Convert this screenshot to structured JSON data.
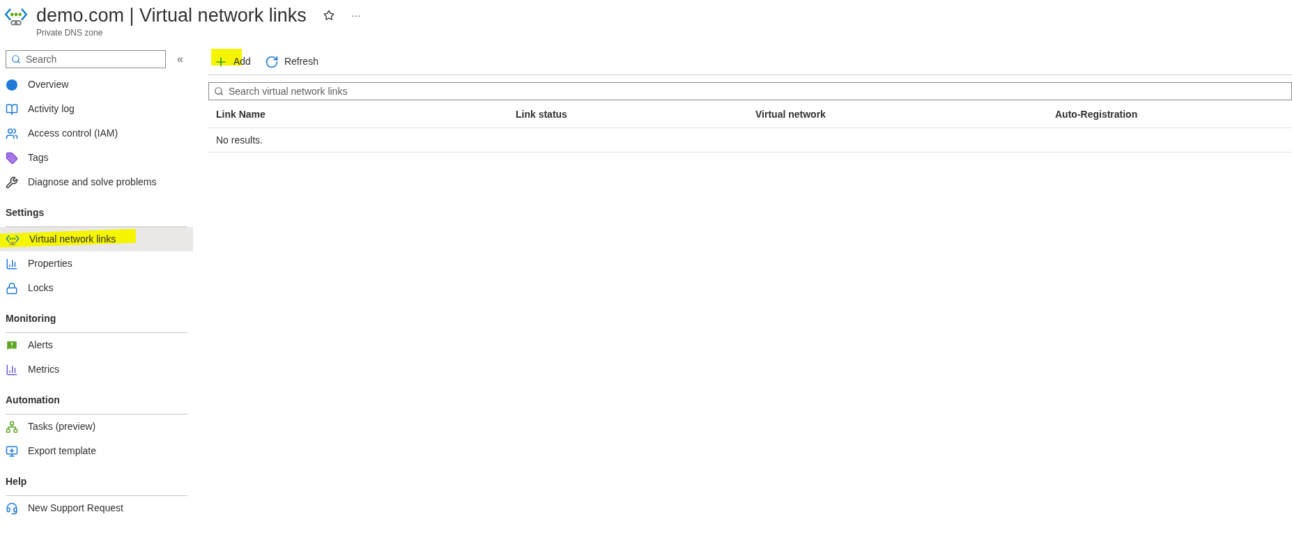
{
  "header": {
    "title": "demo.com | Virtual network links",
    "subtitle": "Private DNS zone",
    "more": "···"
  },
  "sidebar": {
    "search": {
      "placeholder": "Search"
    },
    "collapse": "«",
    "sections": [
      {
        "items": [
          {
            "label": "Overview",
            "selected": false
          },
          {
            "label": "Activity log",
            "selected": false
          },
          {
            "label": "Access control (IAM)",
            "selected": false
          },
          {
            "label": "Tags",
            "selected": false
          },
          {
            "label": "Diagnose and solve problems",
            "selected": false
          }
        ]
      },
      {
        "heading": "Settings",
        "items": [
          {
            "label": "Virtual network links",
            "selected": true
          },
          {
            "label": "Properties",
            "selected": false
          },
          {
            "label": "Locks",
            "selected": false
          }
        ]
      },
      {
        "heading": "Monitoring",
        "items": [
          {
            "label": "Alerts",
            "selected": false
          },
          {
            "label": "Metrics",
            "selected": false
          }
        ]
      },
      {
        "heading": "Automation",
        "items": [
          {
            "label": "Tasks (preview)",
            "selected": false
          },
          {
            "label": "Export template",
            "selected": false
          }
        ]
      },
      {
        "heading": "Help",
        "items": [
          {
            "label": "New Support Request",
            "selected": false
          }
        ]
      }
    ]
  },
  "toolbar": [
    {
      "label": "Add"
    },
    {
      "label": "Refresh"
    }
  ],
  "search": {
    "placeholder": "Search virtual network links"
  },
  "table": {
    "columns": [
      "Link Name",
      "Link status",
      "Virtual network",
      "Auto-Registration"
    ],
    "empty_message": "No results."
  }
}
